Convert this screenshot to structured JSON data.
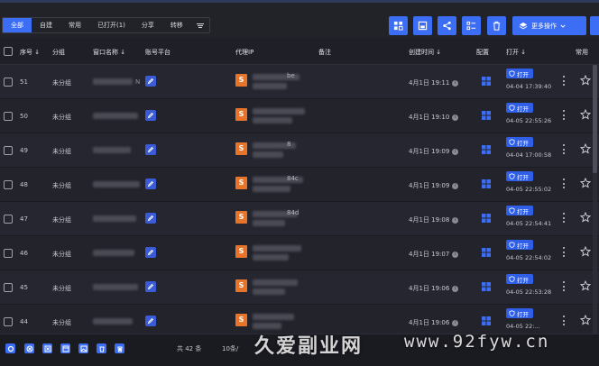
{
  "tabs": [
    {
      "label": "全部",
      "active": true
    },
    {
      "label": "自建",
      "active": false
    },
    {
      "label": "常用",
      "active": false
    },
    {
      "label": "已打开(1)",
      "active": false
    },
    {
      "label": "分享",
      "active": false
    },
    {
      "label": "转移",
      "active": false
    }
  ],
  "toolbar": {
    "more_label": "更多操作",
    "icons": [
      "add-window-icon",
      "copy-icon",
      "share-icon",
      "list-icon",
      "trash-icon",
      "layers-icon"
    ]
  },
  "columns": {
    "seq": "序号",
    "group": "分组",
    "name": "窗口名称",
    "platform": "账号平台",
    "proxy": "代理IP",
    "note": "备注",
    "created": "创建时间",
    "config": "配置",
    "open": "打开",
    "fav": "常用"
  },
  "rows": [
    {
      "seq": "51",
      "group": "未分组",
      "name_hint": "N",
      "proxy_hint": "be",
      "created": "4月1日 19:11",
      "open_label": "打开",
      "open_time": "04-04 17:39:40"
    },
    {
      "seq": "50",
      "group": "未分组",
      "name_hint": "",
      "proxy_hint": "",
      "created": "4月1日 19:10",
      "open_label": "打开",
      "open_time": "04-05 22:55:26"
    },
    {
      "seq": "49",
      "group": "未分组",
      "name_hint": "",
      "proxy_hint": "8",
      "created": "4月1日 19:09",
      "open_label": "打开",
      "open_time": "04-04 17:00:58"
    },
    {
      "seq": "48",
      "group": "未分组",
      "name_hint": "",
      "proxy_hint": "84c",
      "created": "4月1日 19:09",
      "open_label": "打开",
      "open_time": "04-05 22:55:02"
    },
    {
      "seq": "47",
      "group": "未分组",
      "name_hint": "",
      "proxy_hint": "84d",
      "created": "4月1日 19:08",
      "open_label": "打开",
      "open_time": "04-05 22:54:41"
    },
    {
      "seq": "46",
      "group": "未分组",
      "name_hint": "",
      "proxy_hint": "",
      "created": "4月1日 19:07",
      "open_label": "打开",
      "open_time": "04-05 22:54:02"
    },
    {
      "seq": "45",
      "group": "未分组",
      "name_hint": "",
      "proxy_hint": "",
      "created": "4月1日 19:06",
      "open_label": "打开",
      "open_time": "04-05 22:53:28"
    },
    {
      "seq": "44",
      "group": "未分组",
      "name_hint": "",
      "proxy_hint": "",
      "created": "4月1日 19:06",
      "open_label": "打开",
      "open_time": "04-05 22:..."
    }
  ],
  "footer": {
    "total": "共 42 条",
    "per_page": "10条/"
  },
  "watermark": {
    "text_cn": "久爱副业网",
    "text_url": "www.92fyw.cn"
  },
  "colors": {
    "accent": "#3b6df5",
    "proxy_badge": "#e8742a",
    "bg": "#1c1c24"
  }
}
